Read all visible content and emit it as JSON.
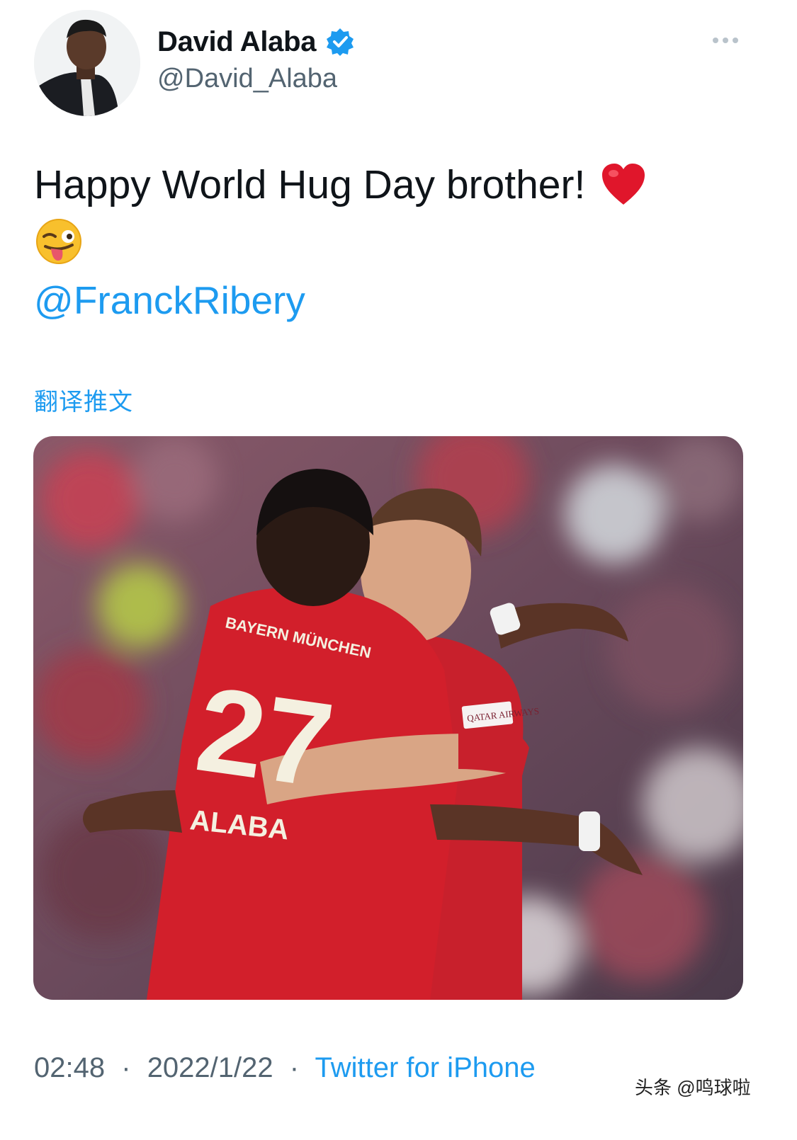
{
  "profile": {
    "display_name": "David Alaba",
    "handle": "@David_Alaba",
    "verified": true,
    "avatar_icon": "avatar-photo"
  },
  "tweet": {
    "text_line1": "Happy World Hug Day brother!",
    "emoji1": "red-heart",
    "emoji2": "winking-face-with-tongue",
    "mention": "@FranckRibery",
    "translate_label": "翻译推文"
  },
  "media": {
    "jersey_name": "ALABA",
    "jersey_number": "27",
    "jersey_club": "BAYERN MÜNCHEN",
    "sponsor": "QATAR AIRWAYS"
  },
  "meta": {
    "time": "02:48",
    "separator": "·",
    "date": "2022/1/22",
    "source": "Twitter for iPhone"
  },
  "watermark": "头条 @鸣球啦",
  "colors": {
    "accent": "#1d9bf0",
    "text": "#0f1419",
    "secondary": "#536471",
    "jersey_red": "#d21f2b"
  }
}
